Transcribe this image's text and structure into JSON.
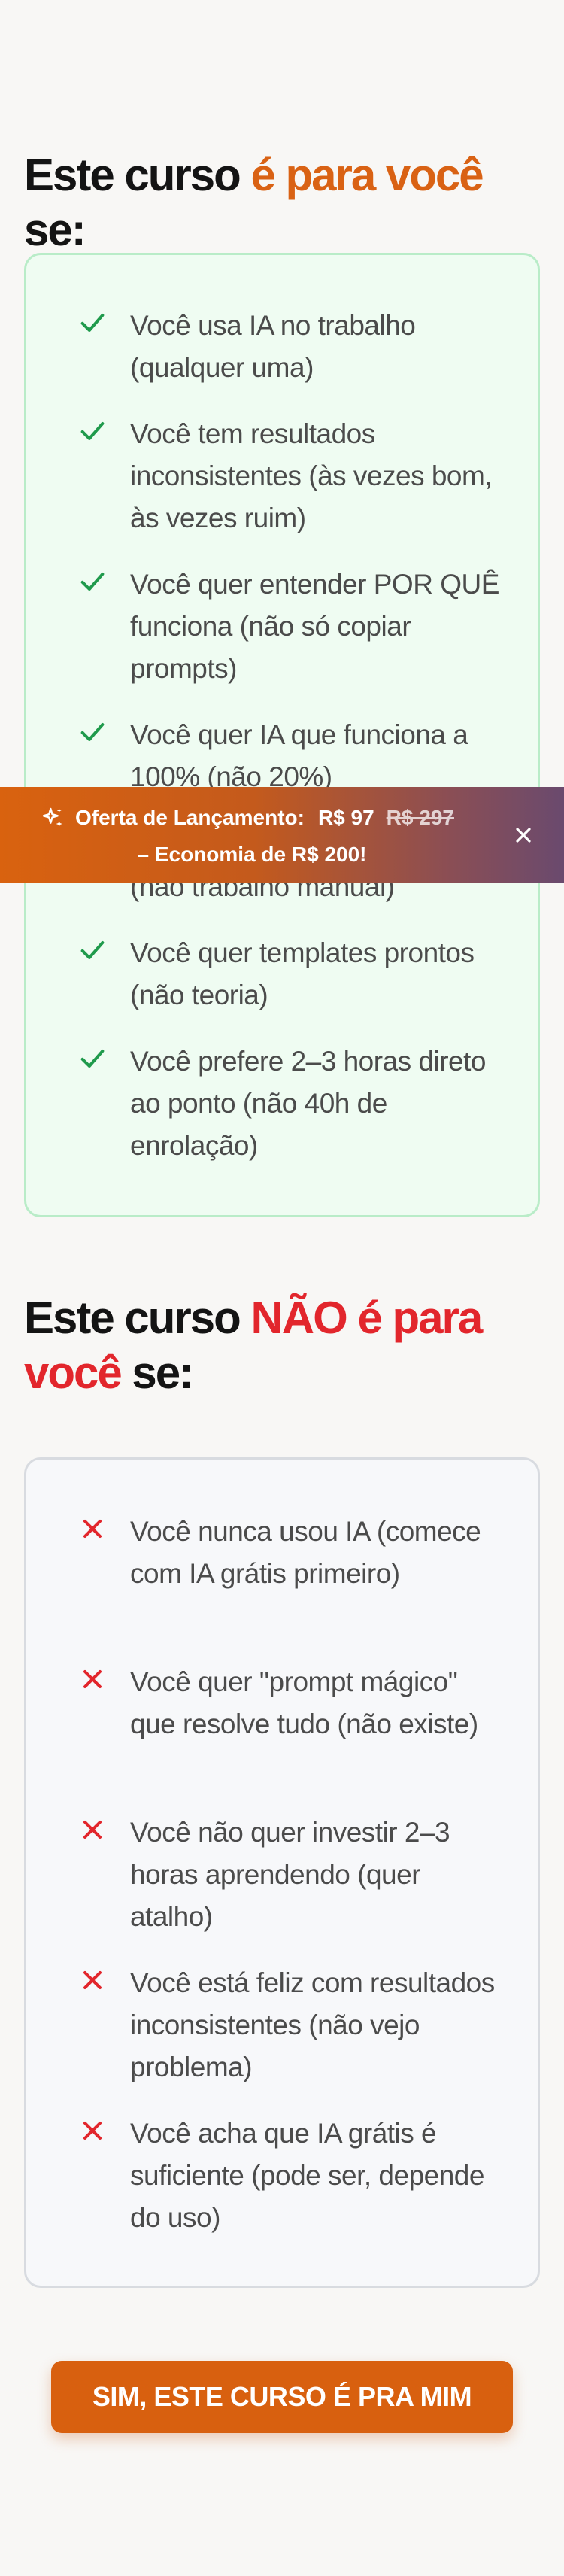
{
  "for_you": {
    "title_part1": "Este curso ",
    "title_accent": "é para você",
    "title_part2": " se:",
    "items": [
      "Você usa IA no trabalho (qualquer uma)",
      "Você tem resultados inconsistentes (às vezes bom, às vezes ruim)",
      "Você quer entender POR QUÊ funciona (não só copiar prompts)",
      "Você quer IA que funciona a 100% (não 20%)",
      "(não trabalho manual)",
      "Você quer templates prontos (não teoria)",
      "Você prefere 2–3 horas direto ao ponto (não 40h de enrolação)"
    ]
  },
  "not_for_you": {
    "title_part1": "Este curso ",
    "title_accent": "NÃO é para você",
    "title_part2": " se:",
    "items": [
      "Você nunca usou IA (comece com IA grátis primeiro)",
      "Você quer \"prompt mágico\" que resolve tudo (não existe)",
      "Você não quer investir 2–3 horas aprendendo (quer atalho)",
      "Você está feliz com resultados inconsistentes (não vejo problema)",
      "Você acha que IA grátis é suficiente (pode ser, depende do uso)"
    ]
  },
  "banner": {
    "icon": "sparkle-icon",
    "label": "Oferta de Lançamento:",
    "price": "R$ 97",
    "old_price": "R$ 297",
    "savings": "– Economia de R$ 200!",
    "close_icon": "close-icon"
  },
  "cta": {
    "label": "SIM, ESTE CURSO É PRA MIM"
  },
  "colors": {
    "accent_orange": "#d96214",
    "accent_red": "#e2262c",
    "check_green": "#1f9a4c",
    "cross_red": "#e2262c"
  }
}
